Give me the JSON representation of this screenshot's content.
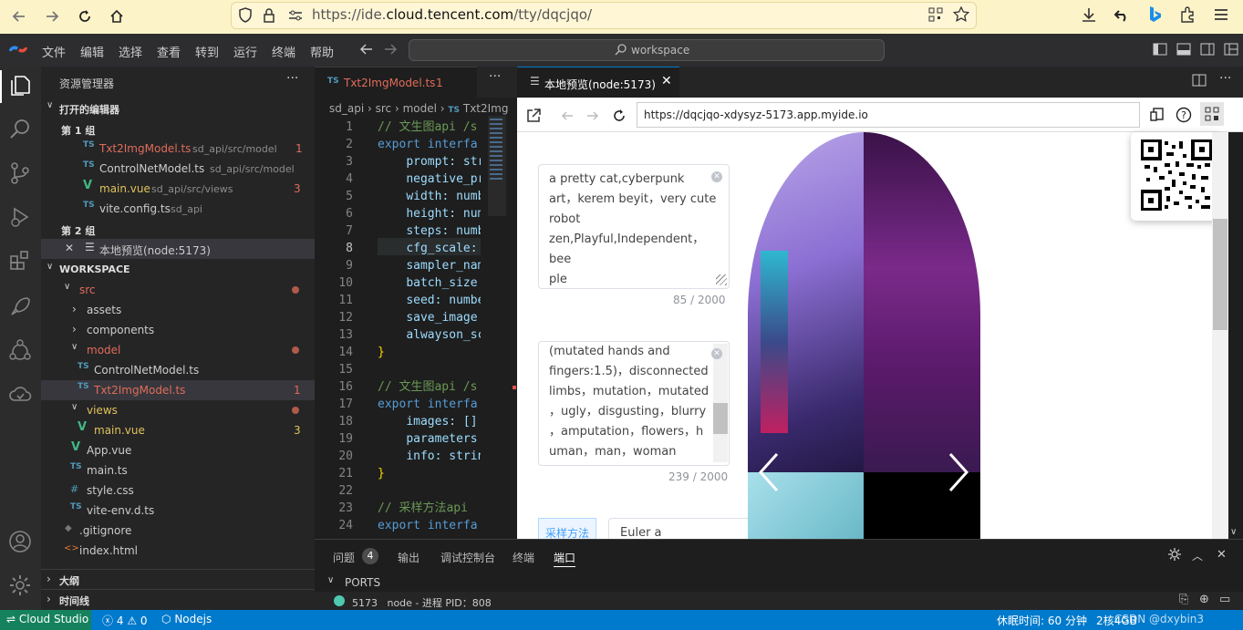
{
  "browser": {
    "url_prefix": "https://ide.",
    "url_domain": "cloud.tencent.com",
    "url_path": "/tty/dqcjqo/"
  },
  "menu": {
    "items": [
      "文件",
      "编辑",
      "选择",
      "查看",
      "转到",
      "运行",
      "终端",
      "帮助"
    ],
    "search": "workspace"
  },
  "explorer": {
    "title": "资源管理器",
    "open_editors": "打开的编辑器",
    "group1": "第 1 组",
    "group1_files": [
      {
        "name": "Txt2ImgModel.ts",
        "path": "sd_api/src/model",
        "badge": "1"
      },
      {
        "name": "ControlNetModel.ts",
        "path": "sd_api/src/model",
        "badge": ""
      },
      {
        "name": "main.vue",
        "path": "sd_api/src/views",
        "badge": "3"
      },
      {
        "name": "vite.config.ts",
        "path": "sd_api",
        "badge": ""
      }
    ],
    "group2": "第 2 组",
    "group2_file": "本地预览(node:5173)",
    "workspace": "WORKSPACE",
    "tree": {
      "src": "src",
      "assets": "assets",
      "components": "components",
      "model": "model",
      "controlnet": "ControlNetModel.ts",
      "txt2img": "Txt2ImgModel.ts",
      "txt2img_badge": "1",
      "views": "views",
      "mainvue": "main.vue",
      "mainvue_badge": "3",
      "appvue": "App.vue",
      "maints": "main.ts",
      "stylecss": "style.css",
      "viteenv": "vite-env.d.ts",
      "gitignore": ".gitignore",
      "indexhtml": "index.html"
    },
    "outline": "大纲",
    "timeline": "时间线"
  },
  "editor": {
    "tab": "Txt2ImgModel.ts",
    "tab_badge": "1",
    "breadcrumb": [
      "sd_api",
      "src",
      "model",
      "Txt2Img"
    ],
    "lines": [
      "1",
      "2",
      "3",
      "4",
      "5",
      "6",
      "7",
      "8",
      "9",
      "10",
      "11",
      "12",
      "13",
      "14",
      "15",
      "16",
      "17",
      "18",
      "19",
      "20",
      "21",
      "22",
      "23",
      "24"
    ]
  },
  "preview": {
    "tab": "本地预览(node:5173)",
    "url": "https://dqcjqo-xdysyz-5173.app.myide.io",
    "prompt_lines": [
      "a pretty cat,cyberpunk",
      "art，kerem beyit，very cute",
      "robot",
      "zen,Playful,Independent，bee",
      "ple"
    ],
    "prompt_count": "85 / 2000",
    "neg_lines": [
      "(mutated hands and",
      "fingers:1.5)，disconnected",
      "limbs，mutation，mutated",
      "，ugly，disgusting，blurry",
      "，amputation，flowers，h",
      "uman，man，woman"
    ],
    "neg_count": "239 / 2000",
    "sampler_label": "采样方法",
    "sampler_value": "Euler a"
  },
  "panel": {
    "tabs": [
      "问题",
      "输出",
      "调试控制台",
      "终端",
      "端口"
    ],
    "problems_count": "4",
    "ports_title": "PORTS",
    "port_row": "5173   node - 进程 PID：808"
  },
  "status": {
    "brand": "Cloud Studio",
    "errors": "4",
    "warnings": "0",
    "runtime": "Nodejs",
    "sleep": "休眠时间: 60 分钟",
    "spec": "2核4GB",
    "watermark": "CSDN @dxybin3"
  }
}
